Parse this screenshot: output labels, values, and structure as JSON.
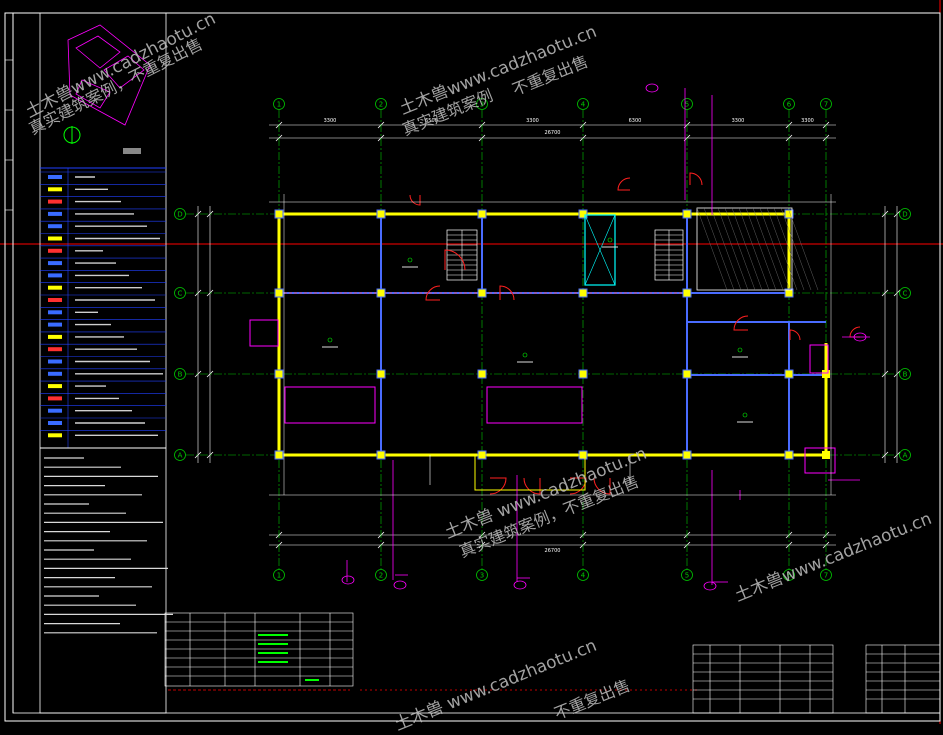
{
  "watermark": {
    "line1": "土木兽www.cadzhaotu.cn",
    "line2": "真实建筑案例，不重复出售",
    "line2_left": "真实建筑案例",
    "line2_right": "不重复出售",
    "right_frag1": "土木兽www.cadzhaotu.cn",
    "bottom_line1": "土木兽 www.cadzhaotu.cn",
    "bottom_line2": "真实建筑案例，不重复出售"
  },
  "grid_columns_top": [
    "1",
    "2",
    "3",
    "4",
    "5",
    "6",
    "7"
  ],
  "grid_columns_bottom": [
    "1",
    "2",
    "3",
    "4",
    "5",
    "6",
    "7"
  ],
  "grid_rows_left": [
    "D",
    "C",
    "B",
    "A"
  ],
  "grid_rows_right": [
    "D",
    "C",
    "B",
    "A"
  ],
  "dims_top": [
    "3300",
    "6500",
    "3300",
    "6300",
    "3300",
    "3300"
  ],
  "dims_top_total": "26700",
  "dims_bottom_total": "26700",
  "colors": {
    "grid_axis": "#00c800",
    "wall": "#ffff00",
    "door": "#ff2020",
    "dim": "#ffffff",
    "frame": "#ffffff",
    "callout": "#ff00ff",
    "legend_line": "#2040ff",
    "cyan": "#00ffff",
    "axis_ref": "#ff0000"
  }
}
